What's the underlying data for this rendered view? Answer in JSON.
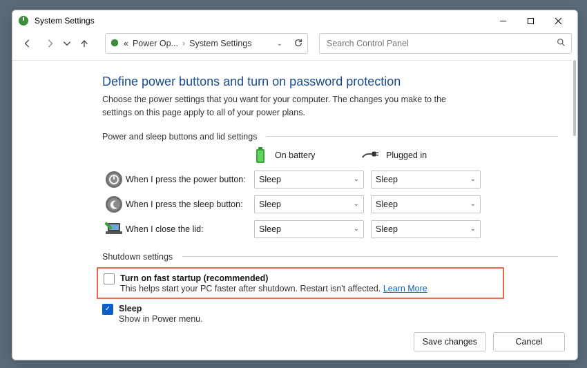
{
  "window": {
    "title": "System Settings"
  },
  "breadcrumb": {
    "prefix": "«",
    "item1": "Power Op...",
    "item2": "System Settings"
  },
  "search": {
    "placeholder": "Search Control Panel"
  },
  "page": {
    "heading": "Define power buttons and turn on password protection",
    "description": "Choose the power settings that you want for your computer. The changes you make to the settings on this page apply to all of your power plans.",
    "section1": "Power and sleep buttons and lid settings",
    "col_battery": "On battery",
    "col_plugged": "Plugged in",
    "rows": {
      "power": {
        "label": "When I press the power button:",
        "battery": "Sleep",
        "plugged": "Sleep"
      },
      "sleep": {
        "label": "When I press the sleep button:",
        "battery": "Sleep",
        "plugged": "Sleep"
      },
      "lid": {
        "label": "When I close the lid:",
        "battery": "Sleep",
        "plugged": "Sleep"
      }
    },
    "section2": "Shutdown settings",
    "fast": {
      "label": "Turn on fast startup (recommended)",
      "sub": "This helps start your PC faster after shutdown. Restart isn't affected. ",
      "learn": "Learn More"
    },
    "sleep_opt": {
      "label": "Sleep",
      "sub": "Show in Power menu."
    }
  },
  "footer": {
    "save": "Save changes",
    "cancel": "Cancel"
  }
}
